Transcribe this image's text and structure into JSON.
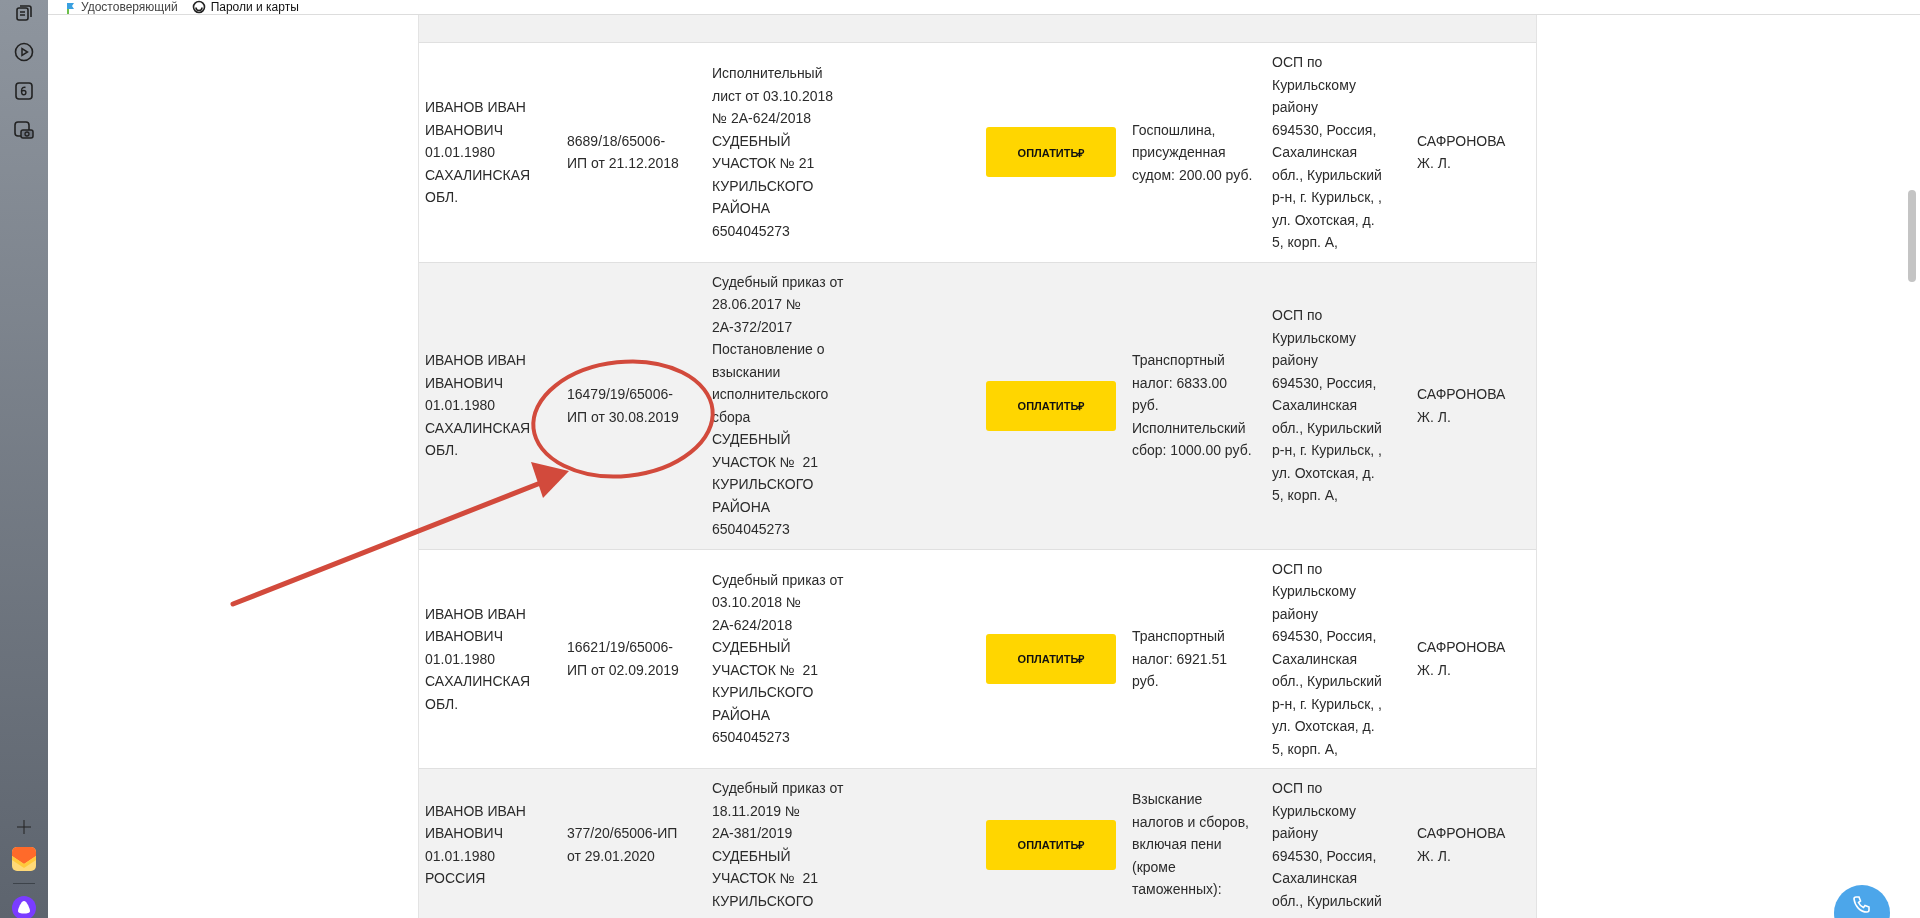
{
  "bookmarks": [
    {
      "label": "Удостоверяющий"
    },
    {
      "label": "Пароли и карты"
    }
  ],
  "table": {
    "rows": [
      {
        "debtor": "ИВАНОВ ИВАН\nИВАНОВИЧ\n01.01.1980\nСАХАЛИНСКАЯ\nОБЛ.",
        "proceeding": "8689/18/65006-\nИП от 21.12.2018",
        "document": "Исполнительный\nлист от 03.10.2018\n№ 2А-624/2018\nСУДЕБНЫЙ\nУЧАСТОК № 21\nКУРИЛЬСКОГО\nРАЙОНА\n6504045273",
        "pay_button": "ОПЛАТИТЬ₽",
        "charge": "Госпошлина,\nприсужденная\nсудом: 200.00 руб.",
        "department": "ОСП по\nКурильскому\nрайону\n694530, Россия,\nСахалинская\nобл., Курильский\nр-н, г. Курильск, ,\nул. Охотская, д.\n5, корп. А,",
        "bailiff": "САФРОНОВА\nЖ. Л."
      },
      {
        "debtor": "ИВАНОВ ИВАН\nИВАНОВИЧ\n01.01.1980\nСАХАЛИНСКАЯ\nОБЛ.",
        "proceeding": "16479/19/65006-\nИП от 30.08.2019",
        "document": "Судебный приказ от\n28.06.2017 №\n2А-372/2017\nПостановление о\nвзыскании\nисполнительского\nсбора\nСУДЕБНЫЙ\nУЧАСТОК №  21\nКУРИЛЬСКОГО\nРАЙОНА\n6504045273",
        "pay_button": "ОПЛАТИТЬ₽",
        "charge": "Транспортный\nналог: 6833.00\nруб.\nИсполнительский\nсбор: 1000.00 руб.",
        "department": "ОСП по\nКурильскому\nрайону\n694530, Россия,\nСахалинская\nобл., Курильский\nр-н, г. Курильск, ,\nул. Охотская, д.\n5, корп. А,",
        "bailiff": "САФРОНОВА\nЖ. Л."
      },
      {
        "debtor": "ИВАНОВ ИВАН\nИВАНОВИЧ\n01.01.1980\nСАХАЛИНСКАЯ\nОБЛ.",
        "proceeding": "16621/19/65006-\nИП от 02.09.2019",
        "document": "Судебный приказ от\n03.10.2018 №\n2А-624/2018\nСУДЕБНЫЙ\nУЧАСТОК №  21\nКУРИЛЬСКОГО\nРАЙОНА\n6504045273",
        "pay_button": "ОПЛАТИТЬ₽",
        "charge": "Транспортный\nналог: 6921.51\nруб.",
        "department": "ОСП по\nКурильскому\nрайону\n694530, Россия,\nСахалинская\nобл., Курильский\nр-н, г. Курильск, ,\nул. Охотская, д.\n5, корп. А,",
        "bailiff": "САФРОНОВА\nЖ. Л."
      },
      {
        "debtor": "ИВАНОВ ИВАН\nИВАНОВИЧ\n01.01.1980\nРОССИЯ",
        "proceeding": "377/20/65006-ИП\nот 29.01.2020",
        "document": "Судебный приказ от\n18.11.2019 №\n2А-381/2019\nСУДЕБНЫЙ\nУЧАСТОК №  21\nКУРИЛЬСКОГО",
        "pay_button": "ОПЛАТИТЬ₽",
        "charge": "Взыскание\nналогов и сборов,\nвключая пени\n(кроме\nтаможенных):",
        "department": "ОСП по\nКурильскому\nрайону\n694530, Россия,\nСахалинская\nобл., Курильский",
        "bailiff": "САФРОНОВА\nЖ. Л."
      }
    ]
  }
}
